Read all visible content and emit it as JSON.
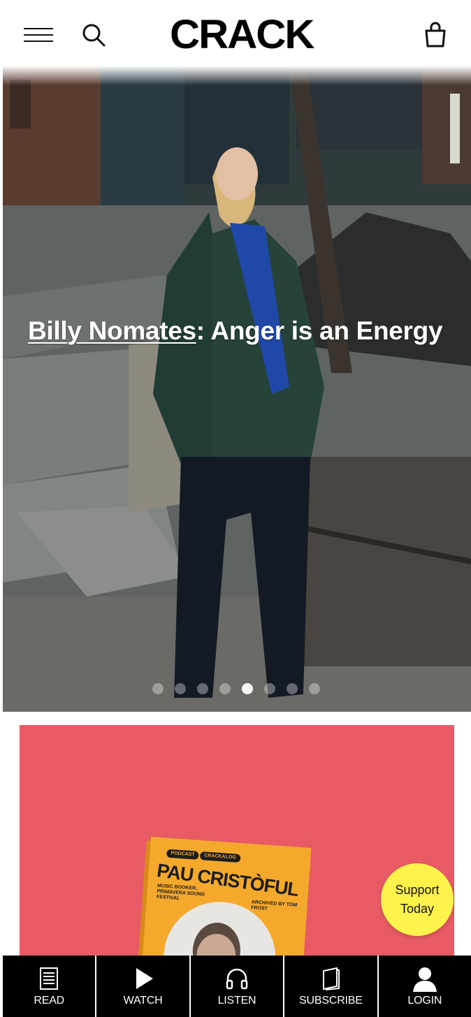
{
  "header": {
    "logo_text": "CRACK",
    "menu_icon": "hamburger-menu-icon",
    "search_icon": "search-icon",
    "cart_icon": "shopping-bag-icon"
  },
  "hero": {
    "title_link": "Billy Nomates",
    "title_rest": ": Anger is an Energy",
    "slides_total": 8,
    "active_slide": 5
  },
  "promo": {
    "tag_1": "PODCAST",
    "tag_2": "CRACKALOG",
    "album_title": "PAU CRISTÒFUL",
    "subtitle": "MUSIC BOOKER, PRIMAVERA SOUND FESTIVAL",
    "credit": "ARCHIVED BY TOM FROST",
    "background_color": "#e85b64",
    "album_color": "#f4a82c"
  },
  "support": {
    "line1": "Support",
    "line2": "Today",
    "color": "#fff34b"
  },
  "bottom_nav": {
    "items": [
      {
        "label": "READ",
        "icon": "newspaper-icon"
      },
      {
        "label": "WATCH",
        "icon": "play-icon"
      },
      {
        "label": "LISTEN",
        "icon": "headphones-icon"
      },
      {
        "label": "SUBSCRIBE",
        "icon": "magazine-icon"
      },
      {
        "label": "LOGIN",
        "icon": "user-icon"
      }
    ]
  }
}
